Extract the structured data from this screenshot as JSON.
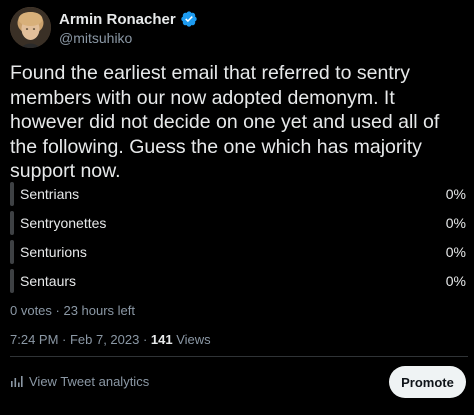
{
  "author": {
    "display_name": "Armin Ronacher",
    "handle": "@mitsuhiko",
    "verified": true
  },
  "tweet": {
    "text": "Found the earliest email that referred to sentry members with our now adopted demonym. It however did not decide on one yet and used all of the following. Guess the one which has majority support now."
  },
  "poll": {
    "options": [
      {
        "label": "Sentrians",
        "percent_label": "0%",
        "percent": 0
      },
      {
        "label": "Sentryonettes",
        "percent_label": "0%",
        "percent": 0
      },
      {
        "label": "Senturions",
        "percent_label": "0%",
        "percent": 0
      },
      {
        "label": "Sentaurs",
        "percent_label": "0%",
        "percent": 0
      }
    ],
    "meta": "0 votes · 23 hours left"
  },
  "timestamp": {
    "text": "7:24 PM · Feb 7, 2023 · ",
    "views_count": "141",
    "views_label": " Views"
  },
  "footer": {
    "analytics_label": "View Tweet analytics",
    "promote_label": "Promote"
  },
  "colors": {
    "background": "#000000",
    "text": "#e7e9ea",
    "muted": "#8b98a5",
    "verified_badge": "#1d9bf0",
    "promote_bg": "#eff3f4"
  },
  "icons": [
    "avatar",
    "verified-badge-icon",
    "analytics-icon"
  ]
}
